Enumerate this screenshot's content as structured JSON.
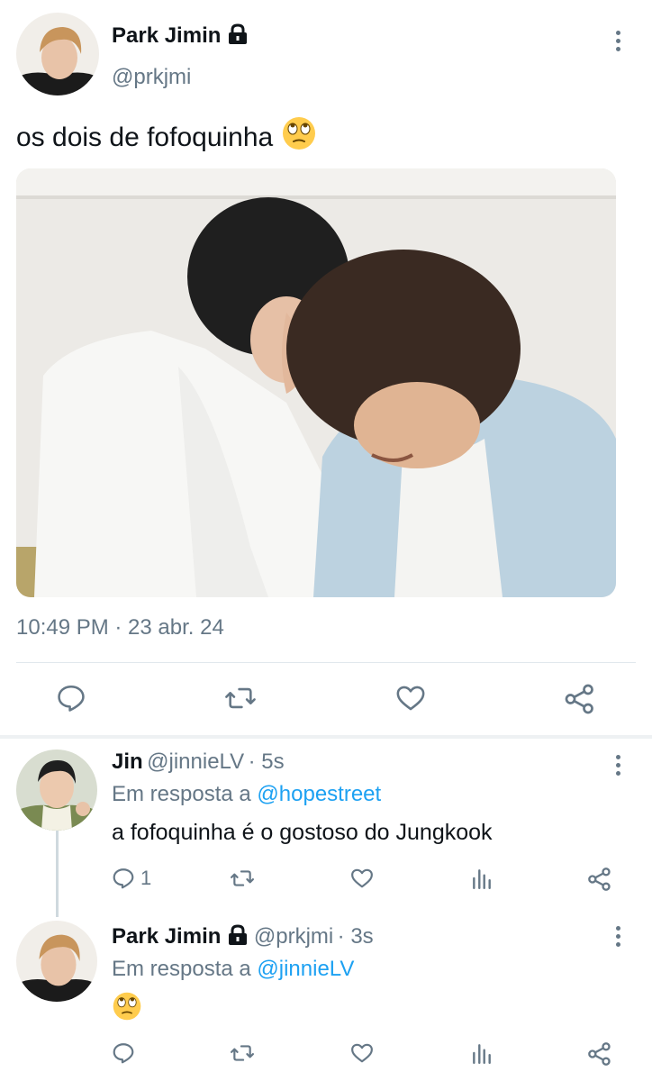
{
  "main_tweet": {
    "author_name": "Park Jimin",
    "handle": "@prkjmi",
    "text": "os dois de fofoquinha",
    "emoji": "face-with-rolling-eyes",
    "timestamp": "10:49 PM · 23 abr. 24",
    "protected": true
  },
  "replies": [
    {
      "author_name": "Jin",
      "handle": "@jinnieLV",
      "time": "· 5s",
      "reply_prefix": "Em resposta a",
      "reply_to": "@hopestreet",
      "text": "a fofoquinha é o gostoso do Jungkook",
      "reply_count": "1",
      "protected": false
    },
    {
      "author_name": "Park Jimin",
      "handle": "@prkjmi",
      "time": "· 3s",
      "reply_prefix": "Em resposta a",
      "reply_to": "@jinnieLV",
      "emoji": "face-with-rolling-eyes",
      "reply_count": "",
      "protected": true
    }
  ],
  "colors": {
    "text": "#0f1419",
    "secondary": "#657786",
    "link": "#1da1f2",
    "divider": "#e1e8ed"
  },
  "icons": {
    "more": "more-vertical-icon",
    "lock": "lock-icon",
    "reply": "reply-icon",
    "retweet": "retweet-icon",
    "like": "heart-icon",
    "analytics": "analytics-icon",
    "share": "share-icon"
  }
}
